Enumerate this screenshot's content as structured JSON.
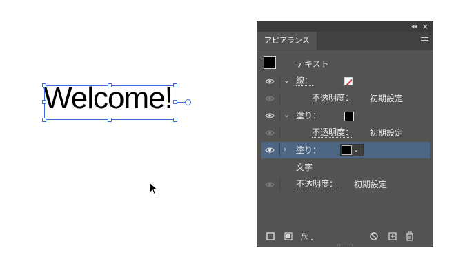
{
  "canvas": {
    "text": "Welcome!"
  },
  "panel": {
    "tab_label": "アピアランス",
    "rows": {
      "object": {
        "label": "テキスト"
      },
      "stroke": {
        "label": "線：",
        "opacity_label": "不透明度：",
        "opacity_value": "初期設定"
      },
      "fill": {
        "label": "塗り：",
        "opacity_label": "不透明度：",
        "opacity_value": "初期設定"
      },
      "fill_selected": {
        "label": "塗り："
      },
      "characters": {
        "label": "文字"
      },
      "opacity": {
        "label": "不透明度：",
        "value": "初期設定"
      }
    },
    "footer_icons": [
      "add-new-stroke-icon",
      "add-new-fill-icon",
      "add-new-effect-icon",
      "clear-appearance-icon",
      "duplicate-item-icon",
      "delete-item-icon"
    ]
  },
  "colors": {
    "selection": "#3b6fd6",
    "panel_bg": "#535353",
    "row_highlight": "#4c6683",
    "none_slash": "#dd2222"
  }
}
